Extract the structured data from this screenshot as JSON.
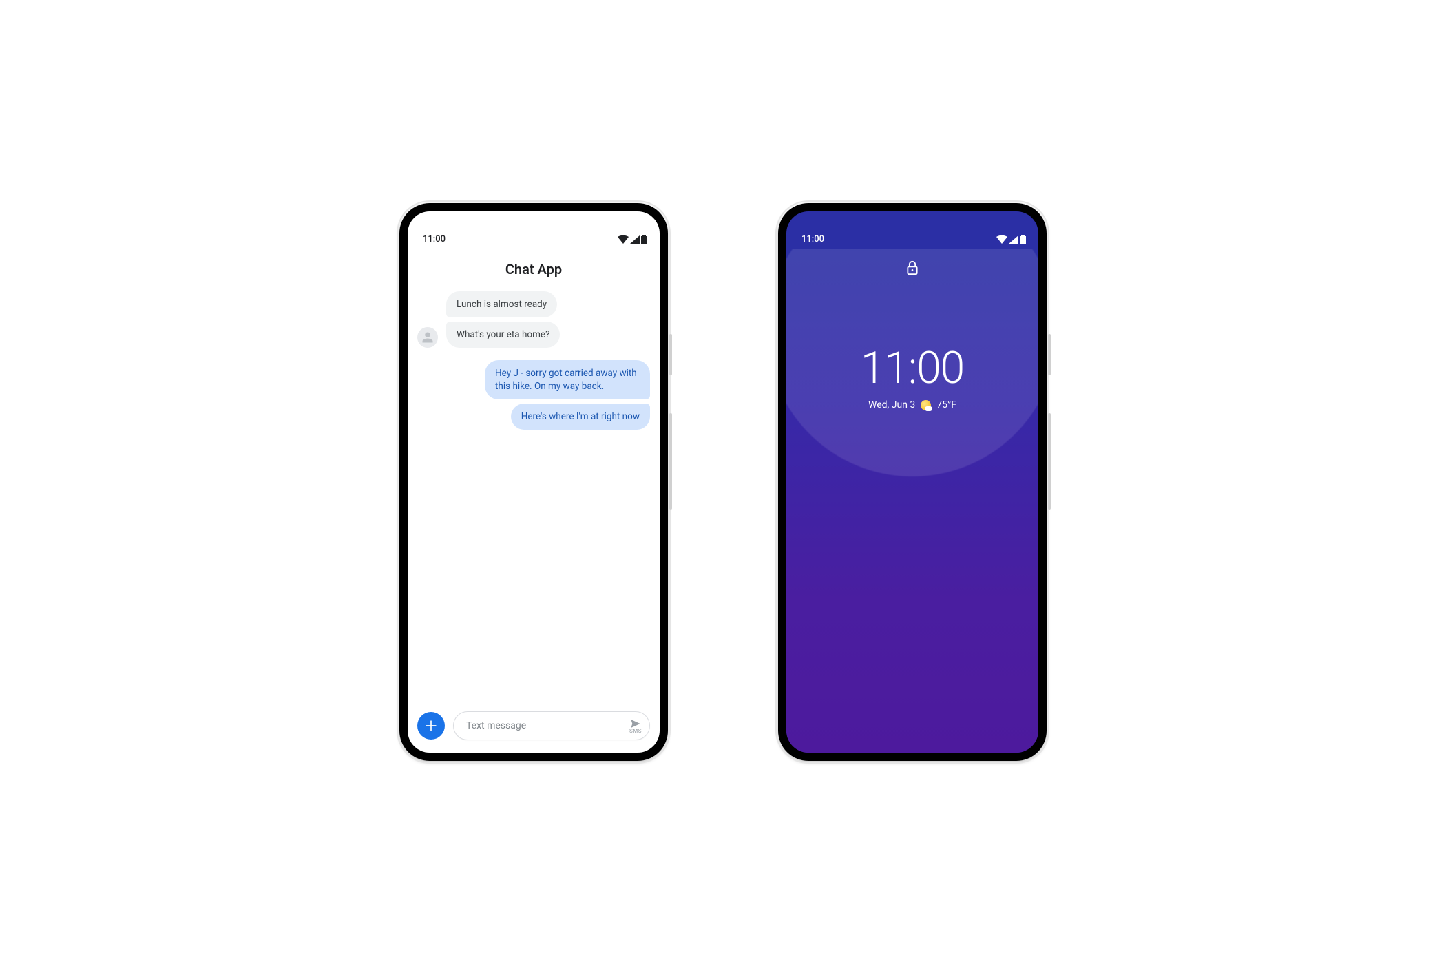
{
  "left": {
    "status": {
      "time": "11:00"
    },
    "app_title": "Chat App",
    "messages": {
      "in1": "Lunch is almost ready",
      "in2": "What's your eta home?",
      "out1": "Hey J - sorry got carried away with this hike. On my way back.",
      "out2": "Here's where I'm at right now"
    },
    "compose": {
      "placeholder": "Text message",
      "small_label": "SMS"
    }
  },
  "right": {
    "status": {
      "time": "11:00"
    },
    "clock": "11:00",
    "date": "Wed, Jun 3",
    "temperature": "75°F"
  },
  "icons": {
    "avatar": "person-icon",
    "add": "plus-icon",
    "send": "send-icon",
    "lock": "lock-icon",
    "weather": "partly-cloudy-icon"
  }
}
